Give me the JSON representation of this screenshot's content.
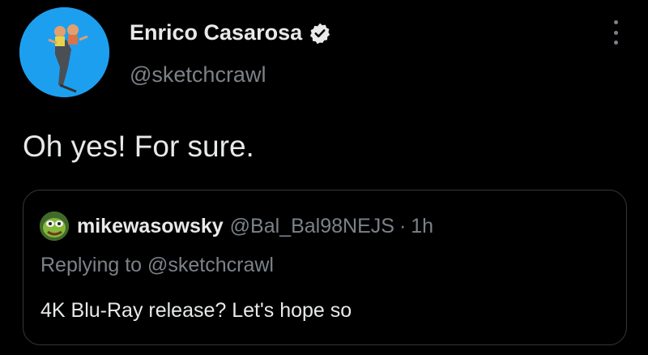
{
  "tweet": {
    "author": {
      "name": "Enrico Casarosa",
      "handle": "@sketchcrawl",
      "verified": true
    },
    "text": "Oh yes! For sure.",
    "menu_icon": "more-vertical-icon"
  },
  "quote": {
    "author_name": "mikewasowsky",
    "author_handle": "@Bal_Bal98NEJS",
    "separator": "·",
    "time": "1h",
    "replying_to": "Replying to @sketchcrawl",
    "text": "4K Blu-Ray release? Let's hope so"
  },
  "colors": {
    "background": "#000000",
    "text_primary": "#e7e9ea",
    "text_secondary": "#7c8288",
    "card_border": "#33373b",
    "avatar_bg": "#1d9ff0"
  }
}
